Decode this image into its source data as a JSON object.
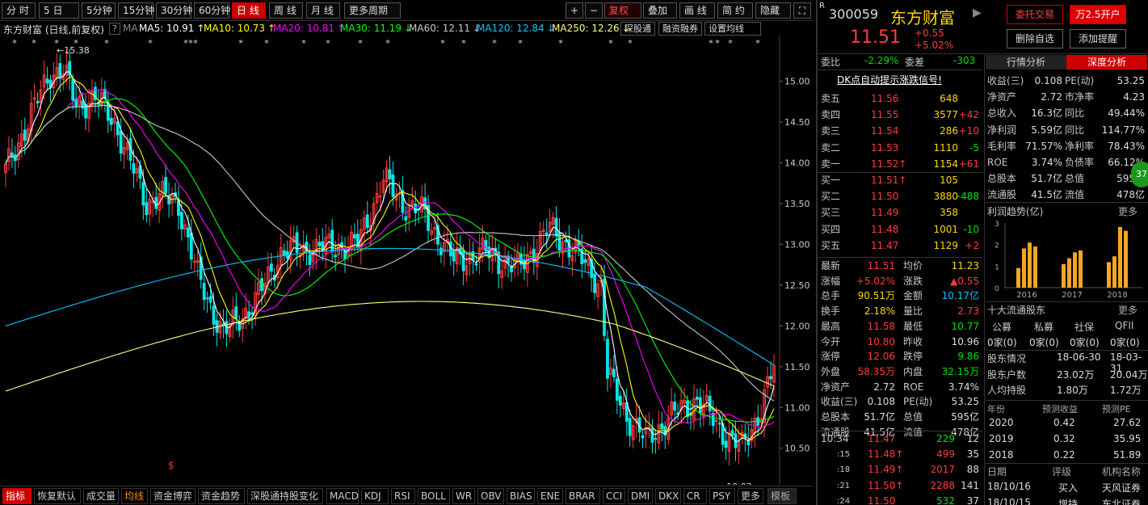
{
  "period_tabs": [
    "分 时",
    "5 日",
    "5分钟",
    "15分钟",
    "30分钟",
    "60分钟",
    "日 线",
    "周 线",
    "月 线",
    "更多周期"
  ],
  "active_period": "日 线",
  "toolbar_right": {
    "plus": "+",
    "minus": "−",
    "fuquan": "复权",
    "diejia": "叠加",
    "huaxian": "画 线",
    "jianyue": "简 约",
    "yincang": "隐藏",
    "expand": "⛶"
  },
  "ma_bar": {
    "title": "东方财富 (日线,前复权)",
    "help": "?",
    "ma_label": "MA",
    "items": [
      {
        "text": "MA5: 10.91",
        "arrow": "↑",
        "color": "#ffffff"
      },
      {
        "text": "MA10: 10.73",
        "arrow": "↑",
        "color": "#ffff00"
      },
      {
        "text": "MA20: 10.81",
        "arrow": "↑",
        "color": "#ff00ff"
      },
      {
        "text": "MA30: 11.19",
        "arrow": "↓",
        "color": "#00ff00"
      },
      {
        "text": "MA60: 12.11",
        "arrow": "↓",
        "color": "#c8c8c8"
      },
      {
        "text": "MA120: 12.84",
        "arrow": "↓",
        "color": "#00c8ff"
      },
      {
        "text": "MA250: 12.26",
        "arrow": "↓",
        "color": "#ffff80"
      }
    ],
    "btn1": "深股通",
    "btn2": "融资融券",
    "btn3": "设置均线"
  },
  "chart_data": {
    "type": "candlestick",
    "y_ticks": [
      "15.00",
      "14.50",
      "14.00",
      "13.50",
      "13.00",
      "12.50",
      "12.00",
      "11.50",
      "11.00",
      "10.50"
    ],
    "ylim": [
      10.2,
      15.55
    ],
    "max_label": "15.38",
    "min_label": "10.03",
    "dollar_marker": "$",
    "colors": {
      "up": "#ff3c3c",
      "down": "#00e8e8",
      "ma5": "#ffffff",
      "ma10": "#ffff00",
      "ma20": "#ff00ff",
      "ma30": "#00ff00",
      "ma60": "#c8c8c8",
      "ma120": "#00c8ff",
      "ma250": "#ffff80"
    }
  },
  "bottom_tabs": [
    "指标",
    "恢复默认",
    "成交量",
    "均线",
    "资金博弈",
    "资金趋势",
    "深股通持股变化",
    "MACD",
    "KDJ",
    "RSI",
    "BOLL",
    "WR",
    "OBV",
    "BIAS",
    "ENE",
    "BRAR",
    "CCI",
    "DMI",
    "DKX",
    "CR",
    "PSY",
    "更多",
    "模板"
  ],
  "stock": {
    "code": "300059",
    "name": "东方财富",
    "r_badge": "R",
    "arrow": "▶",
    "price": "11.51",
    "change": "+0.55",
    "pct": "+5.02%",
    "btn_weituo": "委托交易",
    "btn_kaihu": "万2.5开户",
    "btn_del": "删除自选",
    "btn_alert": "添加提醒"
  },
  "weibi": {
    "label": "委比",
    "value": "-2.29%",
    "label2": "委差",
    "value2": "-303"
  },
  "signal": "DK点自动提示涨跌信号!",
  "sells": [
    {
      "label": "卖五",
      "price": "11.56",
      "vol": "648",
      "chg": ""
    },
    {
      "label": "卖四",
      "price": "11.55",
      "vol": "3577",
      "chg": "+42"
    },
    {
      "label": "卖三",
      "price": "11.54",
      "vol": "286",
      "chg": "+10"
    },
    {
      "label": "卖二",
      "price": "11.53",
      "vol": "1110",
      "chg": "-5"
    },
    {
      "label": "卖一",
      "price": "11.52↑",
      "vol": "1154",
      "chg": "+61"
    }
  ],
  "buys": [
    {
      "label": "买一",
      "price": "11.51↑",
      "vol": "105",
      "chg": ""
    },
    {
      "label": "买二",
      "price": "11.50",
      "vol": "3880",
      "chg": "-488"
    },
    {
      "label": "买三",
      "price": "11.49",
      "vol": "358",
      "chg": ""
    },
    {
      "label": "买四",
      "price": "11.48",
      "vol": "1001",
      "chg": "-10"
    },
    {
      "label": "买五",
      "price": "11.47",
      "vol": "1129",
      "chg": "+2"
    }
  ],
  "stats": [
    {
      "l1": "最新",
      "v1": "11.51",
      "l2": "均价",
      "v2": "11.23"
    },
    {
      "l1": "涨幅",
      "v1": "+5.02%",
      "l2": "涨跌",
      "v2": "▲0.55"
    },
    {
      "l1": "总手",
      "v1": "90.51万",
      "l2": "金额",
      "v2": "10.17亿"
    },
    {
      "l1": "换手",
      "v1": "2.18%",
      "l2": "量比",
      "v2": "2.73"
    },
    {
      "l1": "最高",
      "v1": "11.58",
      "l2": "最低",
      "v2": "10.77"
    },
    {
      "l1": "今开",
      "v1": "10.80",
      "l2": "昨收",
      "v2": "10.96"
    },
    {
      "l1": "涨停",
      "v1": "12.06",
      "l2": "跌停",
      "v2": "9.86"
    },
    {
      "l1": "外盘",
      "v1": "58.35万",
      "l2": "内盘",
      "v2": "32.15万"
    },
    {
      "l1": "净资产",
      "v1": "2.72",
      "l2": "ROE",
      "v2": "3.74%"
    },
    {
      "l1": "收益(三)",
      "v1": "0.108",
      "l2": "PE(动)",
      "v2": "53.25"
    },
    {
      "l1": "总股本",
      "v1": "51.7亿",
      "l2": "总值",
      "v2": "595亿"
    },
    {
      "l1": "流通股",
      "v1": "41.5亿",
      "l2": "流值",
      "v2": "478亿"
    }
  ],
  "ticks": [
    {
      "time": "10:34",
      "price": "11.47",
      "vol": "229",
      "n": "12"
    },
    {
      "time": ":15",
      "price": "11.48↑",
      "vol": "499",
      "n": "35"
    },
    {
      "time": ":18",
      "price": "11.49↑",
      "vol": "2017",
      "n": "88"
    },
    {
      "time": ":21",
      "price": "11.50↑",
      "vol": "2288",
      "n": "141"
    },
    {
      "time": ":24",
      "price": "11.50",
      "vol": "532",
      "n": "37"
    }
  ],
  "fund_tabs": {
    "t1": "行情分析",
    "t2": "深度分析"
  },
  "fundamentals": [
    {
      "l1": "收益(三)",
      "v1": "0.108",
      "l2": "PE(动)",
      "v2": "53.25"
    },
    {
      "l1": "净资产",
      "v1": "2.72",
      "l2": "市净率",
      "v2": "4.23"
    },
    {
      "l1": "总收入",
      "v1": "16.3亿",
      "l2": "同比",
      "v2": "49.44%"
    },
    {
      "l1": "净利润",
      "v1": "5.59亿",
      "l2": "同比",
      "v2": "114.77%"
    },
    {
      "l1": "毛利率",
      "v1": "71.57%",
      "l2": "净利率",
      "v2": "78.43%"
    },
    {
      "l1": "ROE",
      "v1": "3.74%",
      "l2": "负债率",
      "v2": "66.12%"
    },
    {
      "l1": "总股本",
      "v1": "51.7亿",
      "l2": "总值",
      "v2": "595亿"
    },
    {
      "l1": "流通股",
      "v1": "41.5亿",
      "l2": "流值",
      "v2": "478亿"
    }
  ],
  "badge": "37",
  "profit": {
    "title": "利润趋势(亿)",
    "more": "更多",
    "years": [
      "2016",
      "2017",
      "2018"
    ],
    "bars": [
      [
        1,
        2,
        2.3,
        2.1
      ],
      [
        1.2,
        1.5,
        1.8,
        1.9
      ],
      [
        1.3,
        1.6,
        3.1,
        2.9
      ]
    ]
  },
  "holders": {
    "title": "十大流通股东",
    "more": "更多",
    "heads": [
      "公募",
      "私募",
      "社保",
      "QFII"
    ],
    "vals": [
      "0家(0)",
      "0家(0)",
      "0家(0)",
      "0家(0)"
    ]
  },
  "holder_stats": [
    {
      "l": "股东情况",
      "a": "18-06-30",
      "b": "18-03-31"
    },
    {
      "l": "股东户数",
      "a": "23.02万",
      "b": "20.04万"
    },
    {
      "l": "人均持股",
      "a": "1.80万",
      "b": "1.72万"
    }
  ],
  "forecast": {
    "heads": [
      "年份",
      "预测收益",
      "预测PE"
    ],
    "rows": [
      [
        "2020",
        "0.42",
        "27.62"
      ],
      [
        "2019",
        "0.32",
        "35.95"
      ],
      [
        "2018",
        "0.22",
        "51.89"
      ]
    ]
  },
  "ratings": {
    "heads": [
      "日期",
      "评级",
      "机构名称"
    ],
    "rows": [
      [
        "18/10/16",
        "买入",
        "天风证券"
      ],
      [
        "18/10/15",
        "增持",
        "东北证券"
      ]
    ]
  }
}
